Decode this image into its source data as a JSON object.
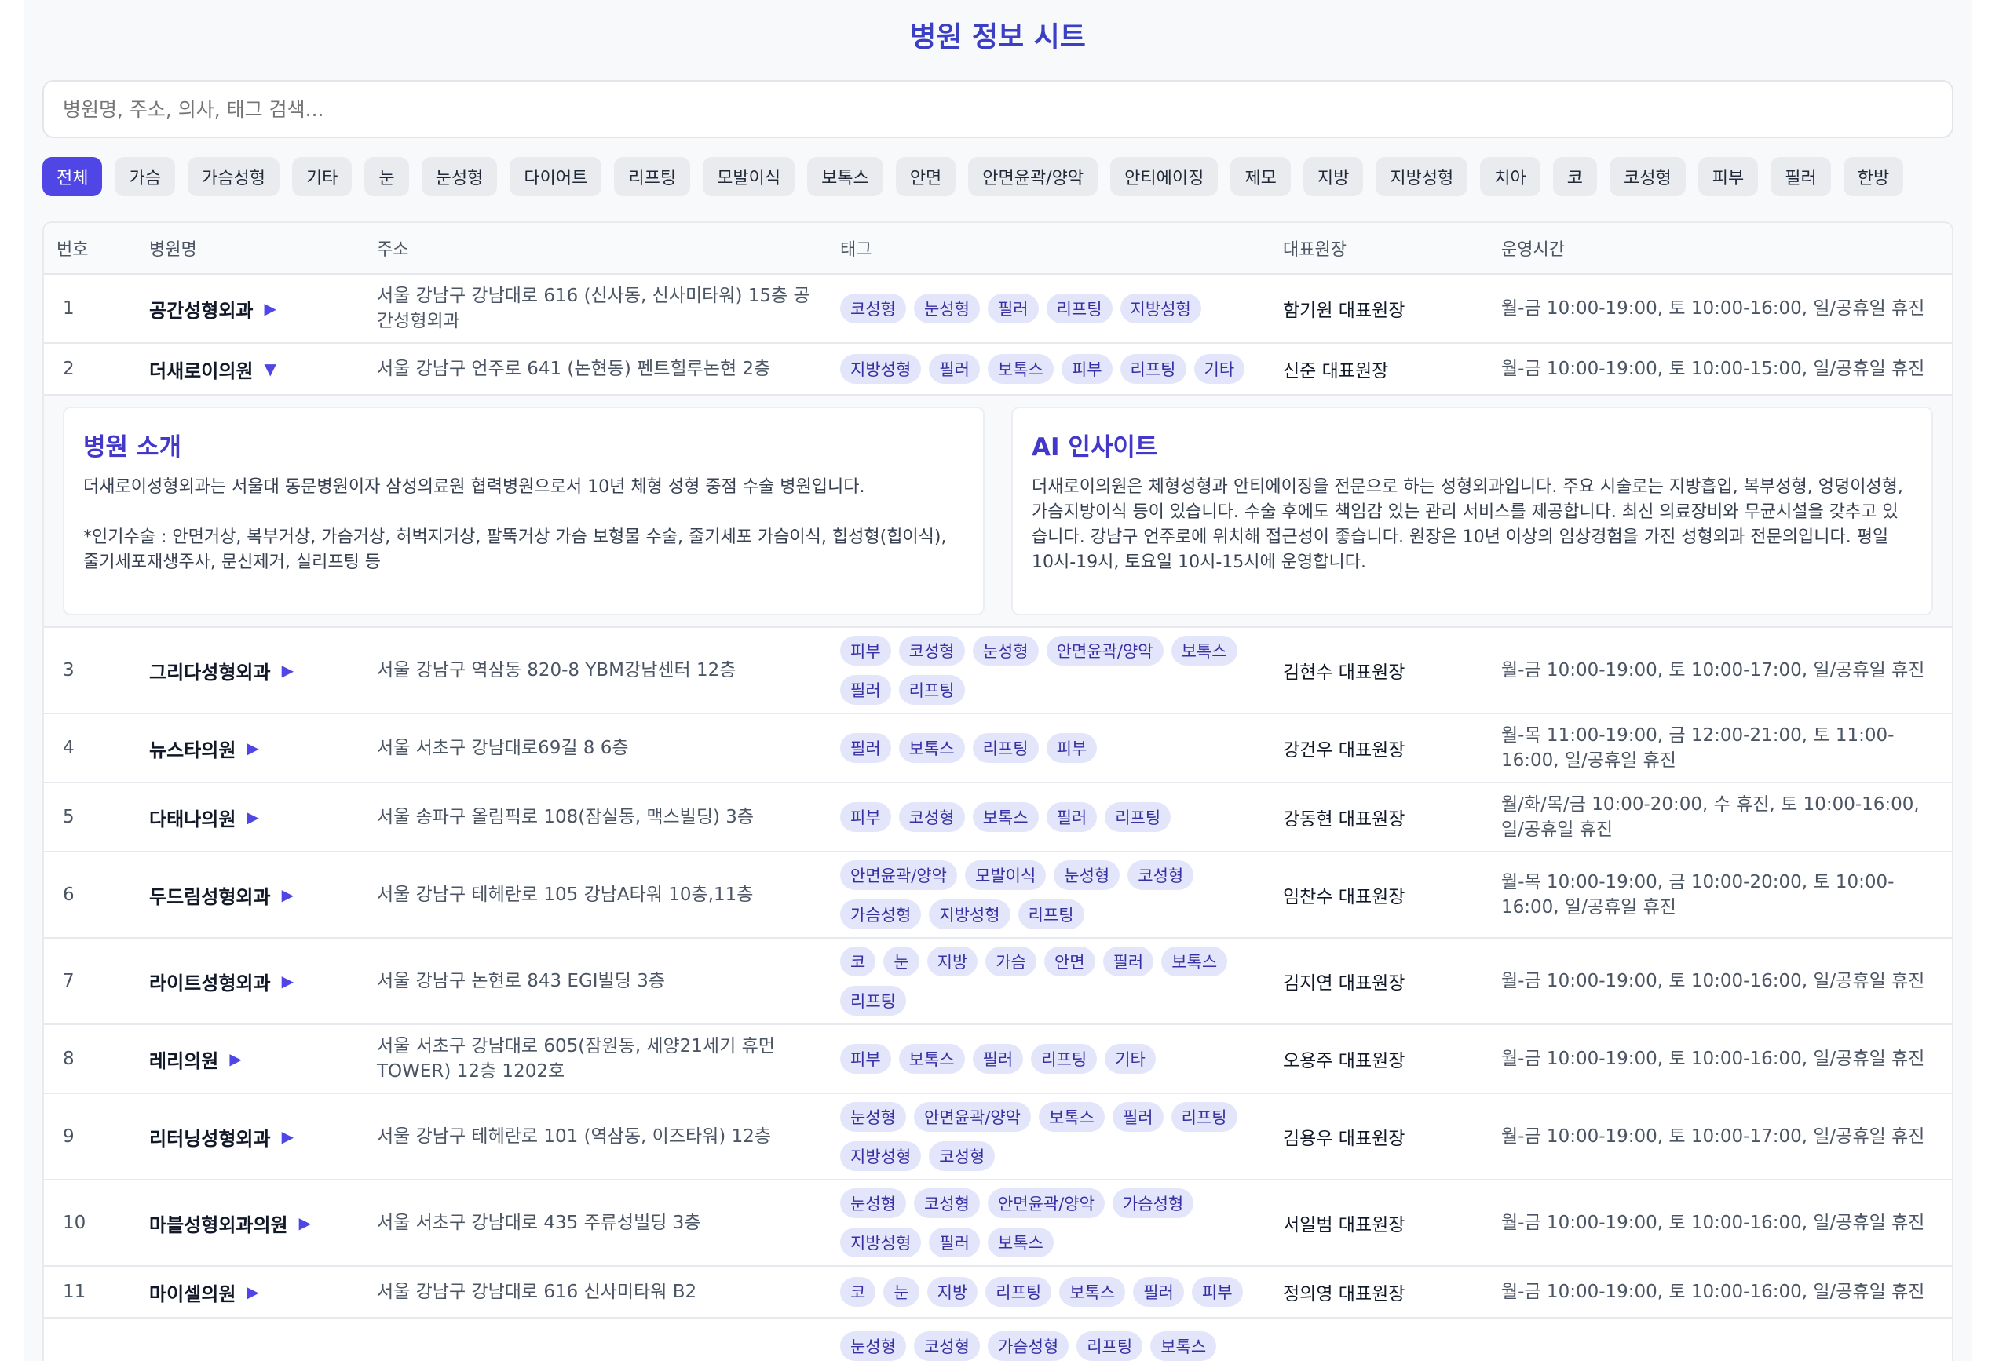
{
  "title": "병원 정보 시트",
  "search": {
    "placeholder": "병원명, 주소, 의사, 태그 검색..."
  },
  "filters": [
    "전체",
    "가슴",
    "가슴성형",
    "기타",
    "눈",
    "눈성형",
    "다이어트",
    "리프팅",
    "모발이식",
    "보톡스",
    "안면",
    "안면윤곽/양악",
    "안티에이징",
    "제모",
    "지방",
    "지방성형",
    "치아",
    "코",
    "코성형",
    "피부",
    "필러",
    "한방"
  ],
  "columns": [
    "번호",
    "병원명",
    "주소",
    "태그",
    "대표원장",
    "운영시간"
  ],
  "rows": [
    {
      "num": "1",
      "name": "공간성형외과",
      "arrow": "▶",
      "address": "서울 강남구 강남대로 616 (신사동, 신사미타워) 15층 공간성형외과",
      "tags": [
        "코성형",
        "눈성형",
        "필러",
        "리프팅",
        "지방성형"
      ],
      "doctor": "함기원 대표원장",
      "hours": "월-금 10:00-19:00, 토 10:00-16:00, 일/공휴일 휴진"
    },
    {
      "num": "2",
      "name": "더새로이의원",
      "arrow": "▼",
      "address": "서울 강남구 언주로 641 (논현동) 펜트힐루논현 2층",
      "tags": [
        "지방성형",
        "필러",
        "보톡스",
        "피부",
        "리프팅",
        "기타"
      ],
      "doctor": "신준 대표원장",
      "hours": "월-금 10:00-19:00, 토 10:00-15:00, 일/공휴일 휴진"
    },
    {
      "num": "3",
      "name": "그리다성형외과",
      "arrow": "▶",
      "address": "서울 강남구 역삼동 820-8 YBM강남센터 12층",
      "tags": [
        "피부",
        "코성형",
        "눈성형",
        "안면윤곽/양악",
        "보톡스",
        "필러",
        "리프팅"
      ],
      "doctor": "김현수 대표원장",
      "hours": "월-금 10:00-19:00, 토 10:00-17:00, 일/공휴일 휴진"
    },
    {
      "num": "4",
      "name": "뉴스타의원",
      "arrow": "▶",
      "address": "서울 서초구 강남대로69길 8 6층",
      "tags": [
        "필러",
        "보톡스",
        "리프팅",
        "피부"
      ],
      "doctor": "강건우 대표원장",
      "hours": "월-목 11:00-19:00, 금 12:00-21:00, 토 11:00-16:00, 일/공휴일 휴진"
    },
    {
      "num": "5",
      "name": "다태나의원",
      "arrow": "▶",
      "address": "서울 송파구 올림픽로 108(잠실동, 맥스빌딩) 3층",
      "tags": [
        "피부",
        "코성형",
        "보톡스",
        "필러",
        "리프팅"
      ],
      "doctor": "강동현 대표원장",
      "hours": "월/화/목/금 10:00-20:00, 수 휴진, 토 10:00-16:00, 일/공휴일 휴진"
    },
    {
      "num": "6",
      "name": "두드림성형외과",
      "arrow": "▶",
      "address": "서울 강남구 테헤란로 105 강남A타워 10층,11층",
      "tags": [
        "안면윤곽/양악",
        "모발이식",
        "눈성형",
        "코성형",
        "가슴성형",
        "지방성형",
        "리프팅"
      ],
      "doctor": "임찬수 대표원장",
      "hours": "월-목 10:00-19:00, 금 10:00-20:00, 토 10:00-16:00, 일/공휴일 휴진"
    },
    {
      "num": "7",
      "name": "라이트성형외과",
      "arrow": "▶",
      "address": "서울 강남구 논현로 843 EGI빌딩 3층",
      "tags": [
        "코",
        "눈",
        "지방",
        "가슴",
        "안면",
        "필러",
        "보톡스",
        "리프팅"
      ],
      "doctor": "김지연 대표원장",
      "hours": "월-금 10:00-19:00, 토 10:00-16:00, 일/공휴일 휴진"
    },
    {
      "num": "8",
      "name": "레리의원",
      "arrow": "▶",
      "address": "서울 서초구 강남대로 605(잠원동, 세양21세기 휴먼 TOWER) 12층 1202호",
      "tags": [
        "피부",
        "보톡스",
        "필러",
        "리프팅",
        "기타"
      ],
      "doctor": "오용주 대표원장",
      "hours": "월-금 10:00-19:00, 토 10:00-16:00, 일/공휴일 휴진"
    },
    {
      "num": "9",
      "name": "리터닝성형외과",
      "arrow": "▶",
      "address": "서울 강남구 테헤란로 101 (역삼동, 이즈타워) 12층",
      "tags": [
        "눈성형",
        "안면윤곽/양악",
        "보톡스",
        "필러",
        "리프팅",
        "지방성형",
        "코성형"
      ],
      "doctor": "김용우 대표원장",
      "hours": "월-금 10:00-19:00, 토 10:00-17:00, 일/공휴일 휴진"
    },
    {
      "num": "10",
      "name": "마블성형외과의원",
      "arrow": "▶",
      "address": "서울 서초구 강남대로 435 주류성빌딩 3층",
      "tags": [
        "눈성형",
        "코성형",
        "안면윤곽/양악",
        "가슴성형",
        "지방성형",
        "필러",
        "보톡스"
      ],
      "doctor": "서일범 대표원장",
      "hours": "월-금 10:00-19:00, 토 10:00-16:00, 일/공휴일 휴진"
    },
    {
      "num": "11",
      "name": "마이셀의원",
      "arrow": "▶",
      "address": "서울 강남구 강남대로 616 신사미타워 B2",
      "tags": [
        "코",
        "눈",
        "지방",
        "리프팅",
        "보톡스",
        "필러",
        "피부"
      ],
      "doctor": "정의영 대표원장",
      "hours": "월-금 10:00-19:00, 토 10:00-16:00, 일/공휴일 휴진"
    },
    {
      "num": "",
      "name": "",
      "arrow": "",
      "address": "",
      "tags": [
        "눈성형",
        "코성형",
        "가슴성형",
        "리프팅",
        "보톡스"
      ],
      "doctor": "",
      "hours": ""
    }
  ],
  "detail": {
    "intro_title": "병원 소개",
    "intro_text": "더새로이성형외과는 서울대 동문병원이자 삼성의료원 협력병원으로서 10년 체형 성형 중점 수술 병원입니다.\n\n*인기수술 : 안면거상, 복부거상, 가슴거상, 허벅지거상, 팔뚝거상 가슴 보형물 수술, 줄기세포 가슴이식, 힙성형(힙이식), 줄기세포재생주사, 문신제거, 실리프팅 등",
    "ai_title": "AI 인사이트",
    "ai_text": "더새로이의원은 체형성형과 안티에이징을 전문으로 하는 성형외과입니다. 주요 시술로는 지방흡입, 복부성형, 엉덩이성형, 가슴지방이식 등이 있습니다. 수술 후에도 책임감 있는 관리 서비스를 제공합니다. 최신 의료장비와 무균시설을 갖추고 있습니다. 강남구 언주로에 위치해 접근성이 좋습니다. 원장은 10년 이상의 임상경험을 가진 성형외과 전문의입니다. 평일 10시-19시, 토요일 10시-15시에 운영합니다."
  }
}
